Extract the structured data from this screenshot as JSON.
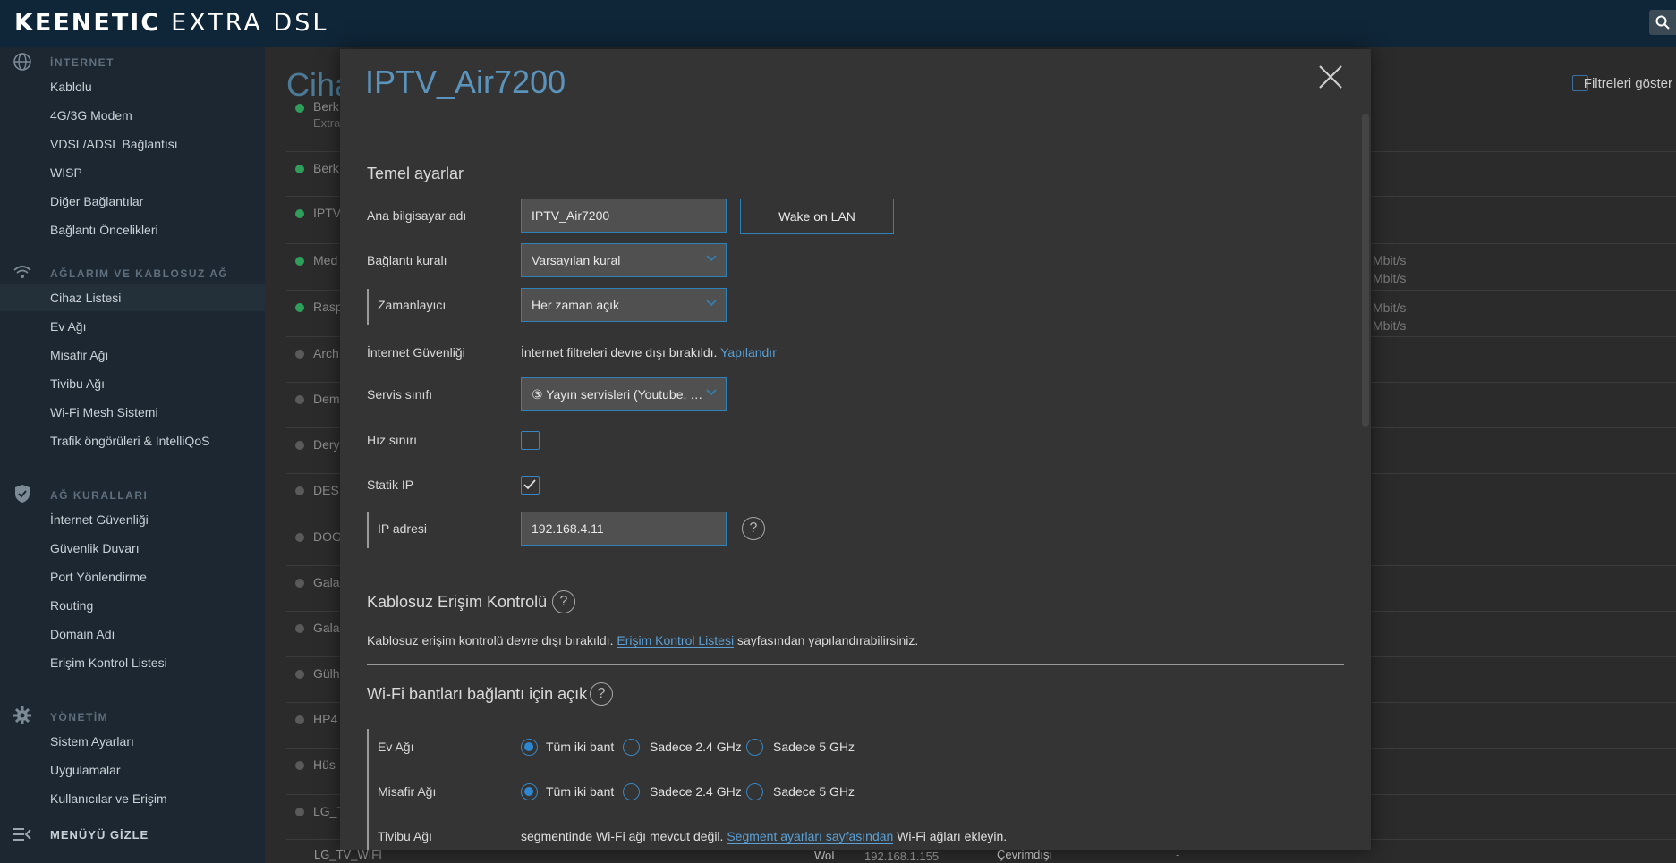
{
  "header": {
    "brand": "KEENETIC",
    "model": "EXTRA DSL"
  },
  "sidebar": {
    "sections": [
      {
        "title": "İNTERNET",
        "icon": "globe-icon",
        "items": [
          "Kablolu",
          "4G/3G Modem",
          "VDSL/ADSL Bağlantısı",
          "WISP",
          "Diğer Bağlantılar",
          "Bağlantı Öncelikleri"
        ]
      },
      {
        "title": "AĞLARIM VE KABLOSUZ AĞ",
        "icon": "wifi-icon",
        "items": [
          "Cihaz Listesi",
          "Ev Ağı",
          "Misafir Ağı",
          "Tivibu Ağı",
          "Wi-Fi Mesh Sistemi",
          "Trafik öngörüleri & IntelliQoS"
        ]
      },
      {
        "title": "AĞ KURALLARI",
        "icon": "shield-icon",
        "items": [
          "İnternet Güvenliği",
          "Güvenlik Duvarı",
          "Port Yönlendirme",
          "Routing",
          "Domain Adı",
          "Erişim Kontrol Listesi"
        ]
      },
      {
        "title": "YÖNETİM",
        "icon": "gear-icon",
        "items": [
          "Sistem Ayarları",
          "Uygulamalar",
          "Kullanıcılar ve Erişim"
        ]
      }
    ],
    "hide_menu": "MENÜYÜ GİZLE"
  },
  "page": {
    "title": "Ciha",
    "filter_label": "Filtreleri göster",
    "rows": [
      {
        "name": "Berk",
        "sub": "Extra",
        "online": true
      },
      {
        "name": "Berk",
        "online": true
      },
      {
        "name": "IPTV",
        "online": true
      },
      {
        "name": "Med",
        "online": true
      },
      {
        "name": "Rasp",
        "online": true
      },
      {
        "name": "Arch",
        "online": false
      },
      {
        "name": "Dem",
        "online": false
      },
      {
        "name": "Dery",
        "online": false
      },
      {
        "name": "DESI",
        "online": false
      },
      {
        "name": "DOG",
        "online": false
      },
      {
        "name": "Gala",
        "online": false
      },
      {
        "name": "Gala",
        "online": false
      },
      {
        "name": "Gülh",
        "online": false
      },
      {
        "name": "HP4",
        "online": false
      },
      {
        "name": "Hüs",
        "online": false
      },
      {
        "name": "LG_T",
        "online": false
      }
    ],
    "rates": [
      "Mbit/s",
      "Mbit/s",
      "Mbit/s",
      "Mbit/s"
    ],
    "bottom_row": {
      "name": "LG_TV_WIFI",
      "wol": "WoL",
      "ip": "192.168.1.155",
      "status": "Çevrimdışı",
      "dash": "-"
    }
  },
  "modal": {
    "title": "IPTV_Air7200",
    "basic_settings": "Temel ayarlar",
    "hostname_label": "Ana bilgisayar adı",
    "hostname_value": "IPTV_Air7200",
    "wol_button": "Wake on LAN",
    "rule_label": "Bağlantı kuralı",
    "rule_value": "Varsayılan kural",
    "scheduler_label": "Zamanlayıcı",
    "scheduler_value": "Her zaman açık",
    "security_label": "İnternet Güvenliği",
    "security_text": "İnternet filtreleri devre dışı bırakıldı.",
    "security_link": "Yapılandır",
    "service_label": "Servis sınıfı",
    "service_value": "③ Yayın servisleri (Youtube, …",
    "speed_label": "Hız sınırı",
    "static_label": "Statik IP",
    "static_checked": true,
    "ip_label": "IP adresi",
    "ip_value": "192.168.4.11",
    "help_glyph": "?",
    "wac_title": "Kablosuz Erişim Kontrolü",
    "wac_text": "Kablosuz erişim kontrolü devre dışı bırakıldı.",
    "wac_link": "Erişim Kontrol Listesi",
    "wac_suffix": "sayfasından yapılandırabilirsiniz.",
    "bands_title": "Wi-Fi bantları bağlantı için açık",
    "bands": [
      {
        "label": "Ev Ağı",
        "options": [
          "Tüm iki bant",
          "Sadece 2.4 GHz",
          "Sadece 5 GHz"
        ],
        "selected": 0
      },
      {
        "label": "Misafir Ağı",
        "options": [
          "Tüm iki bant",
          "Sadece 2.4 GHz",
          "Sadece 5 GHz"
        ],
        "selected": 0
      }
    ],
    "tivibu_label": "Tivibu Ağı",
    "tivibu_text": "segmentinde Wi-Fi ağı mevcut değil.",
    "tivibu_link": "Segment ayarları sayfasından",
    "tivibu_suffix": "Wi-Fi ağları ekleyin."
  },
  "colors": {
    "accent": "#2e82b8",
    "online": "#2e9e5a",
    "offline": "#5a5a5a"
  }
}
